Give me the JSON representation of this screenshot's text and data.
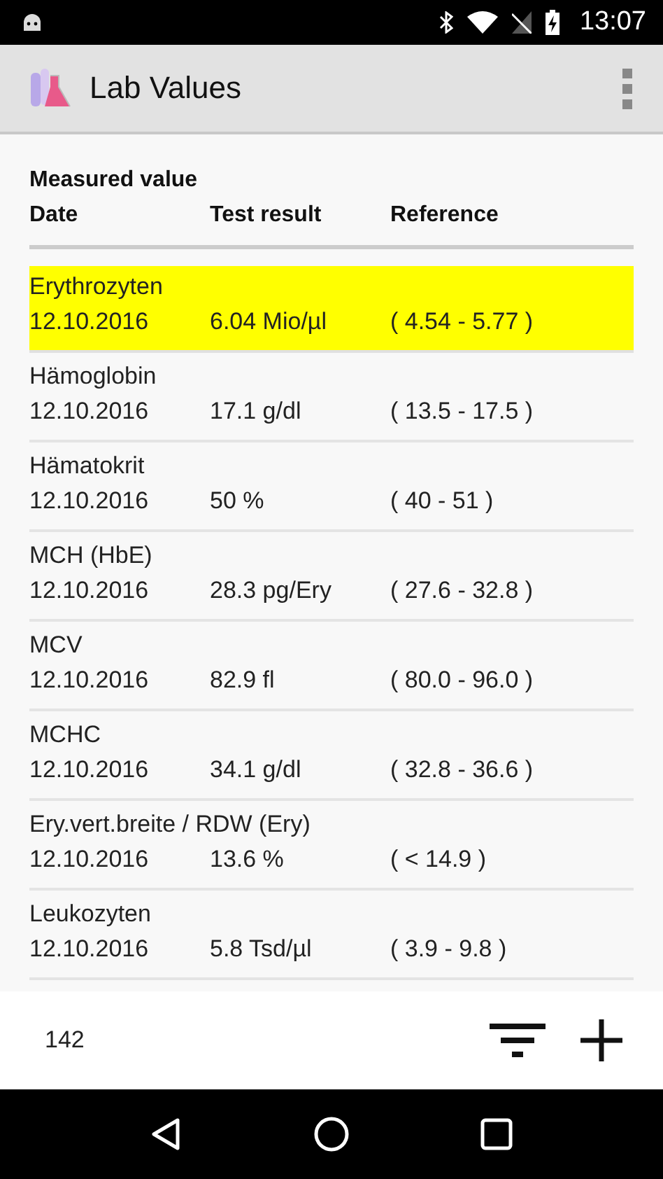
{
  "status_bar": {
    "time": "13:07"
  },
  "app_bar": {
    "title": "Lab Values"
  },
  "table": {
    "group_heading": "Measured value",
    "columns": [
      "Date",
      "Test result",
      "Reference"
    ],
    "rows": [
      {
        "name": "Erythrozyten",
        "date": "12.10.2016",
        "result": "6.04 Mio/µl",
        "reference": "( 4.54 - 5.77 )",
        "highlighted": true
      },
      {
        "name": "Hämoglobin",
        "date": "12.10.2016",
        "result": "17.1 g/dl",
        "reference": "( 13.5 - 17.5 )",
        "highlighted": false
      },
      {
        "name": "Hämatokrit",
        "date": "12.10.2016",
        "result": "50 %",
        "reference": "( 40 - 51 )",
        "highlighted": false
      },
      {
        "name": "MCH (HbE)",
        "date": "12.10.2016",
        "result": "28.3 pg/Ery",
        "reference": "( 27.6 - 32.8 )",
        "highlighted": false
      },
      {
        "name": "MCV",
        "date": "12.10.2016",
        "result": "82.9 fl",
        "reference": "( 80.0 - 96.0 )",
        "highlighted": false
      },
      {
        "name": "MCHC",
        "date": "12.10.2016",
        "result": "34.1 g/dl",
        "reference": "( 32.8 - 36.6 )",
        "highlighted": false
      },
      {
        "name": "Ery.vert.breite / RDW (Ery)",
        "date": "12.10.2016",
        "result": "13.6 %",
        "reference": "( < 14.9 )",
        "highlighted": false
      },
      {
        "name": "Leukozyten",
        "date": "12.10.2016",
        "result": "5.8 Tsd/µl",
        "reference": "( 3.9 - 9.8 )",
        "highlighted": false
      }
    ]
  },
  "footer": {
    "count": "142"
  }
}
